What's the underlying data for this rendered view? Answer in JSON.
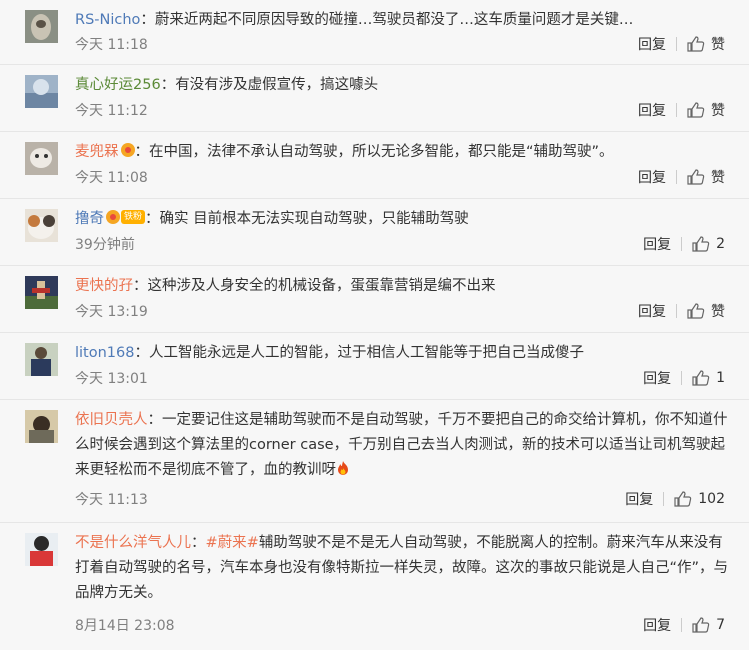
{
  "comments": [
    {
      "user": "RS-Nicho",
      "sep": "：",
      "text": "蔚来近两起不同原因导致的碰撞…驾驶员都没了…这车质量问题才是关键…",
      "time": "今天 11:18",
      "reply": "回复",
      "likes": "赞"
    },
    {
      "user": "真心好运256",
      "sep": "：",
      "text": "有没有涉及虚假宣传，搞这噱头",
      "time": "今天 11:12",
      "reply": "回复",
      "likes": "赞"
    },
    {
      "user": "麦兜槑",
      "sep": "：",
      "text": "在中国，法律不承认自动驾驶，所以无论多智能，都只能是“辅助驾驶”。",
      "time": "今天 11:08",
      "reply": "回复",
      "likes": "赞"
    },
    {
      "user": "撸奇",
      "fan_label": "铁粉",
      "sep": "：",
      "text": "确实 目前根本无法实现自动驾驶，只能辅助驾驶",
      "time": "39分钟前",
      "reply": "回复",
      "likes": "2"
    },
    {
      "user": "更快的孖",
      "sep": "：",
      "text": "这种涉及人身安全的机械设备，蛋蛋靠营销是编不出来",
      "time": "今天 13:19",
      "reply": "回复",
      "likes": "赞"
    },
    {
      "user": "liton168",
      "sep": "：",
      "text": "人工智能永远是人工的智能，过于相信人工智能等于把自己当成傻子",
      "time": "今天 13:01",
      "reply": "回复",
      "likes": "1"
    },
    {
      "user": "依旧贝壳人",
      "sep": "：",
      "text": "一定要记住这是辅助驾驶而不是自动驾驶，千万不要把自己的命交给计算机，你不知道什么时候会遇到这个算法里的corner case，千万别自己去当人肉测试，新的技术可以适当让司机驾驶起来更轻松而不是彻底不管了，血的教训呀",
      "time": "今天 11:13",
      "reply": "回复",
      "likes": "102"
    },
    {
      "user": "不是什么洋气人儿",
      "sep": "：",
      "hashtag": "#蔚来#",
      "text": "辅助驾驶不是不是无人自动驾驶，不能脱离人的控制。蔚来汽车从来没有打着自动驾驶的名号，汽车本身也没有像特斯拉一样失灵，故障。这次的事故只能说是人自己“作”，与品牌方无关。",
      "time": "8月14日 23:08",
      "reply": "回复",
      "likes": "7"
    }
  ]
}
